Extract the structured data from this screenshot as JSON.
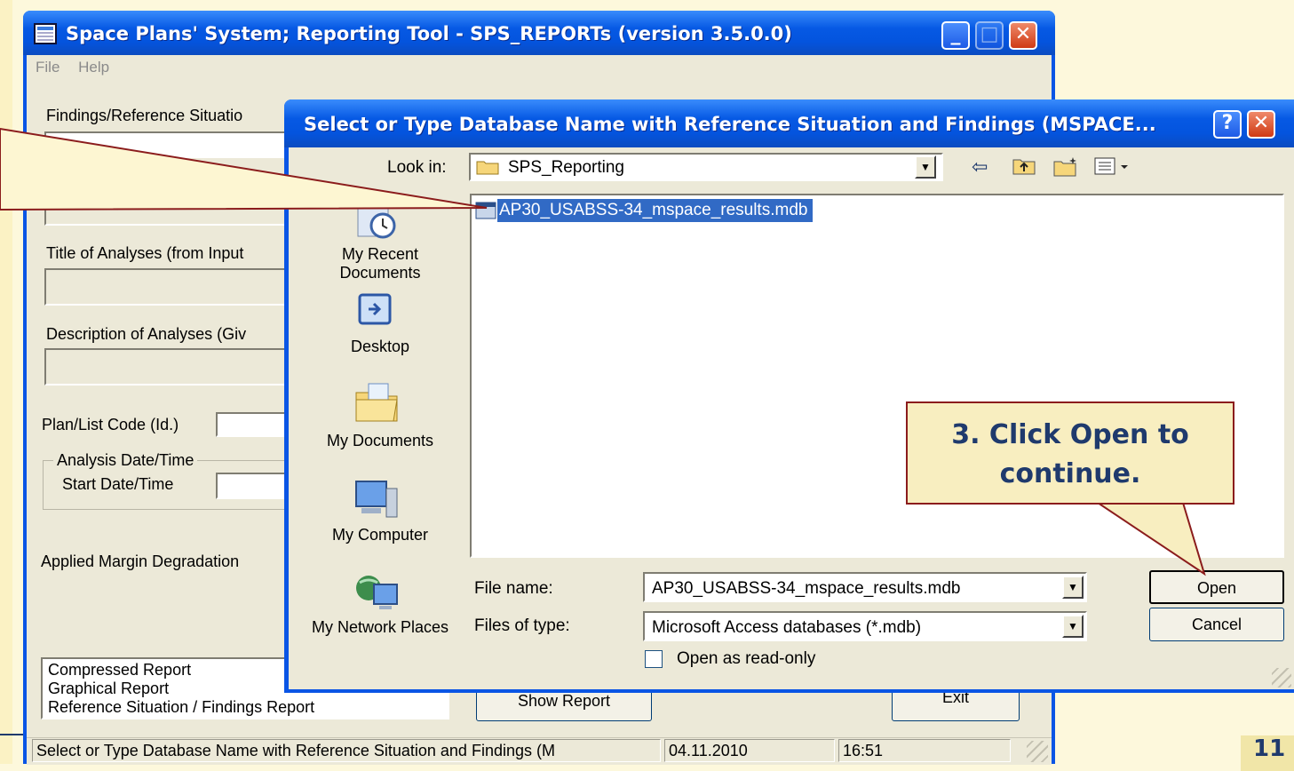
{
  "slide": {
    "page_number": "11"
  },
  "main_window": {
    "title": "Space Plans' System; Reporting Tool - SPS_REPORTs (version 3.5.0.0)",
    "controls": {
      "minimize": "_",
      "maximize": "□",
      "close": "✕"
    },
    "menu": [
      "File",
      "Help"
    ],
    "labels": {
      "findings": "Findings/Reference Situatio",
      "title_analyses": "Title of Analyses (from Input",
      "description_analyses": "Description of Analyses (Giv",
      "plan_code": "Plan/List Code (Id.)",
      "analysis_group": "Analysis Date/Time",
      "start_date": "Start Date/Time",
      "margin": "Applied Margin Degradation"
    },
    "report_list": [
      "Compressed Report",
      "Graphical Report",
      "Reference Situation / Findings Report"
    ],
    "buttons": {
      "show_report": "Show Report",
      "exit": "Exit"
    },
    "status": {
      "message": "Select or Type Database Name with Reference Situation and Findings (M",
      "date": "04.11.2010",
      "time": "16:51"
    }
  },
  "dialog": {
    "title": "Select or Type Database Name with Reference Situation and Findings (MSPACE...",
    "controls": {
      "help": "?",
      "close": "✕"
    },
    "look_in_label": "Look in:",
    "look_in_value": "SPS_Reporting",
    "places": [
      "My Recent Documents",
      "Desktop",
      "My Documents",
      "My Computer",
      "My Network Places"
    ],
    "files": [
      "AP30_USABSS-34_mspace_results.mdb"
    ],
    "file_name_label": "File name:",
    "file_name_value": "AP30_USABSS-34_mspace_results.mdb",
    "file_type_label": "Files of type:",
    "file_type_value": "Microsoft Access databases (*.mdb)",
    "read_only_label": "Open as read-only",
    "buttons": {
      "open": "Open",
      "cancel": "Cancel"
    }
  },
  "callout": {
    "text": "3. Click Open to continue."
  },
  "colors": {
    "titlebar": "#0a55e5",
    "callout_border": "#8b1c1c",
    "callout_text": "#1f3a6d",
    "selection": "#316ac5"
  }
}
